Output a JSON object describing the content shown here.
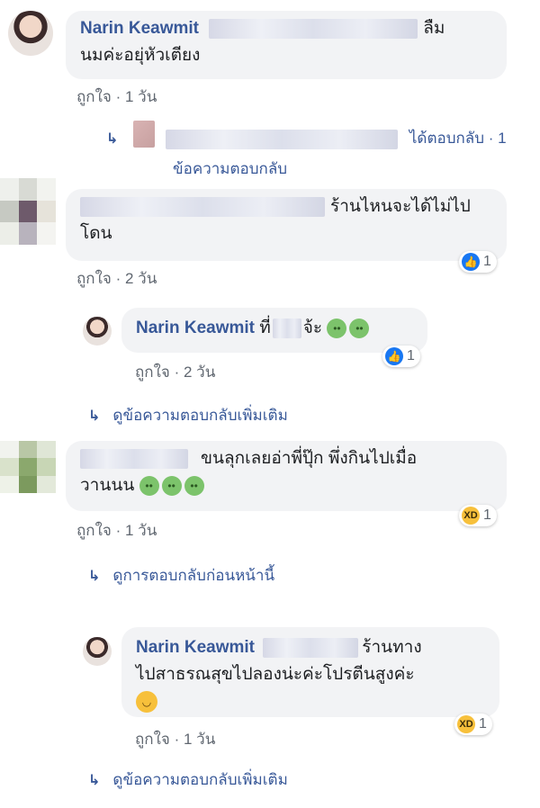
{
  "comments": [
    {
      "author": "Narin Keawmit",
      "text_tail": "ลืม",
      "text_line2": "นมค่ะอยุ่หัวเตียง",
      "like_label": "ถูกใจ",
      "time": "1 วัน",
      "reply_summary": {
        "suffix": "ได้ตอบกลับ · 1",
        "line2": "ข้อความตอบกลับ"
      }
    },
    {
      "text_tail": "ร้านไหนจะได้ไม่ไป",
      "text_line2": "โดน",
      "like_label": "ถูกใจ",
      "time": "2 วัน",
      "reaction": {
        "type": "like",
        "count": "1"
      },
      "reply": {
        "author": "Narin Keawmit",
        "text_a": "ที่",
        "text_b": "จ้ะ",
        "like_label": "ถูกใจ",
        "time": "2 วัน",
        "reaction": {
          "type": "like",
          "count": "1"
        }
      },
      "more_replies": "ดูข้อความตอบกลับเพิ่มเติม"
    },
    {
      "text_tail": "ขนลุกเลยอ่าพี่ปุ๊ก  พึ่งกินไปเมื่อ",
      "text_line2": "วานนน",
      "like_label": "ถูกใจ",
      "time": "1 วัน",
      "reaction": {
        "type": "haha",
        "count": "1"
      },
      "previous_replies": "ดูการตอบกลับก่อนหน้านี้",
      "reply": {
        "author": "Narin Keawmit",
        "text_tail": "ร้านทาง",
        "text_line2": "ไปสาธรณสุขไปลองน่ะค่ะโปรตีนสูงค่ะ",
        "like_label": "ถูกใจ",
        "time": "1 วัน",
        "reaction": {
          "type": "haha",
          "count": "1"
        }
      },
      "more_replies": "ดูข้อความตอบกลับเพิ่มเติม"
    }
  ],
  "icons": {
    "reply_arrow": "reply-arrow-icon",
    "like": "like-icon",
    "haha": "haha-icon",
    "sick_emoji": "nauseated-face-icon",
    "drool_emoji": "drooling-face-icon"
  },
  "colors": {
    "name": "#385898",
    "bubble": "#f2f3f5",
    "meta": "#606770",
    "like_blue": "#1877f2",
    "haha_yellow": "#f7c03b"
  }
}
